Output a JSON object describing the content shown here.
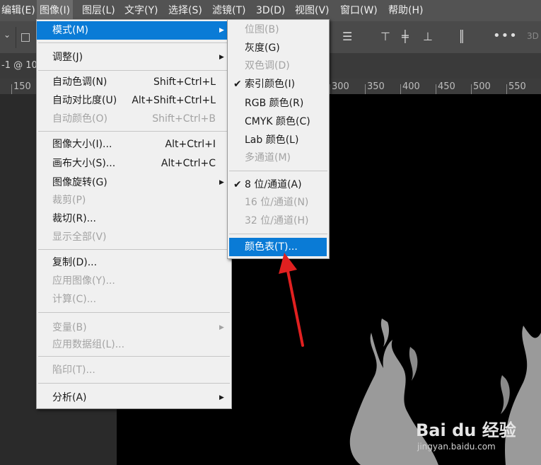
{
  "menubar": {
    "items": [
      {
        "label": "编辑(E)"
      },
      {
        "label": "图像(I)"
      },
      {
        "label": "图层(L)"
      },
      {
        "label": "文字(Y)"
      },
      {
        "label": "选择(S)"
      },
      {
        "label": "滤镜(T)"
      },
      {
        "label": "3D(D)"
      },
      {
        "label": "视图(V)"
      },
      {
        "label": "窗口(W)"
      },
      {
        "label": "帮助(H)"
      }
    ]
  },
  "optbar": {
    "label_3d": "3D"
  },
  "doc_tab": {
    "label": "-1 @ 10"
  },
  "ruler": {
    "labels": [
      "150",
      "300",
      "350",
      "400",
      "450",
      "500",
      "550"
    ]
  },
  "image_menu": {
    "items": [
      {
        "label": "模式(M)",
        "shortcut": "",
        "submenu": true,
        "disabled": false,
        "highlight": true
      },
      {
        "label": "调整(J)",
        "shortcut": "",
        "submenu": true,
        "disabled": false
      },
      {
        "label": "自动色调(N)",
        "shortcut": "Shift+Ctrl+L",
        "disabled": false
      },
      {
        "label": "自动对比度(U)",
        "shortcut": "Alt+Shift+Ctrl+L",
        "disabled": false
      },
      {
        "label": "自动颜色(O)",
        "shortcut": "Shift+Ctrl+B",
        "disabled": true
      },
      {
        "label": "图像大小(I)...",
        "shortcut": "Alt+Ctrl+I",
        "disabled": false
      },
      {
        "label": "画布大小(S)...",
        "shortcut": "Alt+Ctrl+C",
        "disabled": false
      },
      {
        "label": "图像旋转(G)",
        "shortcut": "",
        "submenu": true,
        "disabled": false
      },
      {
        "label": "裁剪(P)",
        "shortcut": "",
        "disabled": true
      },
      {
        "label": "裁切(R)...",
        "shortcut": "",
        "disabled": false
      },
      {
        "label": "显示全部(V)",
        "shortcut": "",
        "disabled": true
      },
      {
        "label": "复制(D)...",
        "shortcut": "",
        "disabled": false
      },
      {
        "label": "应用图像(Y)...",
        "shortcut": "",
        "disabled": true
      },
      {
        "label": "计算(C)...",
        "shortcut": "",
        "disabled": true
      },
      {
        "label": "变量(B)",
        "shortcut": "",
        "submenu": true,
        "disabled": true
      },
      {
        "label": "应用数据组(L)...",
        "shortcut": "",
        "disabled": true
      },
      {
        "label": "陷印(T)...",
        "shortcut": "",
        "disabled": true
      },
      {
        "label": "分析(A)",
        "shortcut": "",
        "submenu": true,
        "disabled": false
      }
    ]
  },
  "mode_menu": {
    "items": [
      {
        "label": "位图(B)",
        "disabled": true
      },
      {
        "label": "灰度(G)",
        "disabled": false
      },
      {
        "label": "双色调(D)",
        "disabled": true
      },
      {
        "label": "索引颜色(I)",
        "disabled": false,
        "checked": true
      },
      {
        "label": "RGB 颜色(R)",
        "disabled": false
      },
      {
        "label": "CMYK 颜色(C)",
        "disabled": false
      },
      {
        "label": "Lab 颜色(L)",
        "disabled": false
      },
      {
        "label": "多通道(M)",
        "disabled": true
      },
      {
        "label": "8 位/通道(A)",
        "disabled": false,
        "checked": true
      },
      {
        "label": "16 位/通道(N)",
        "disabled": true
      },
      {
        "label": "32 位/通道(H)",
        "disabled": true
      },
      {
        "label": "颜色表(T)...",
        "disabled": false,
        "highlight": true
      }
    ]
  },
  "watermark": {
    "brand": "Bai du 经验",
    "url": "jingyan.baidu.com"
  },
  "colors": {
    "highlight": "#0a7bd6",
    "arrow": "#e02020"
  },
  "icons": {
    "check": "check-icon",
    "submenu": "submenu-arrow-icon"
  }
}
